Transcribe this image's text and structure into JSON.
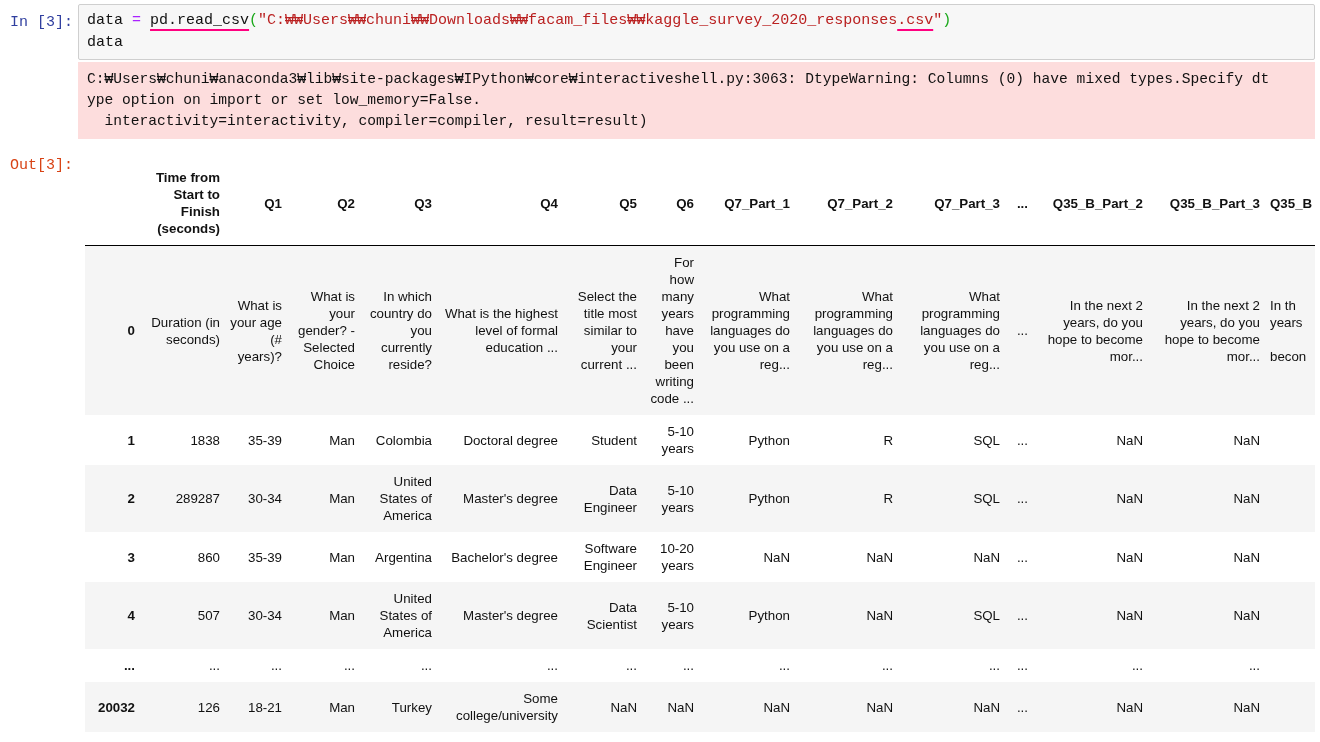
{
  "input_cell": {
    "prompt": "In [3]:",
    "code_lines": [
      [
        {
          "kind": "name",
          "text": "data "
        },
        {
          "kind": "operator",
          "text": "= "
        },
        {
          "kind": "name",
          "text": "pd.read_csv",
          "underlined": true
        },
        {
          "kind": "paren",
          "text": "("
        },
        {
          "kind": "string",
          "text": "\"C:₩₩Users₩₩chuni₩₩Downloads₩₩facam_files₩₩kaggle_survey_2020_responses"
        },
        {
          "kind": "string",
          "text": ".csv",
          "underlined": true
        },
        {
          "kind": "string",
          "text": "\""
        },
        {
          "kind": "paren",
          "text": ")"
        }
      ],
      [
        {
          "kind": "name",
          "text": "data"
        }
      ]
    ]
  },
  "warning_output": {
    "lines": [
      "C:₩Users₩chuni₩anaconda3₩lib₩site-packages₩IPython₩core₩interactiveshell.py:3063: DtypeWarning: Columns (0) have mixed types.Specify dt",
      "ype option on import or set low_memory=False.",
      "  interactivity=interactivity, compiler=compiler, result=result)"
    ]
  },
  "output_cell": {
    "prompt": "Out[3]:",
    "table": {
      "columns": [
        "Time from Start to Finish (seconds)",
        "Q1",
        "Q2",
        "Q3",
        "Q4",
        "Q5",
        "Q6",
        "Q7_Part_1",
        "Q7_Part_2",
        "Q7_Part_3",
        "...",
        "Q35_B_Part_2",
        "Q35_B_Part_3",
        "Q35_B"
      ],
      "rows": [
        {
          "index": "0",
          "cells": [
            "Duration (in seconds)",
            "What is your age (# years)?",
            "What is your gender? - Selected Choice",
            "In which country do you currently reside?",
            "What is the highest level of formal education ...",
            "Select the title most similar to your current ...",
            "For how many years have you been writing code ...",
            "What programming languages do you use on a reg...",
            "What programming languages do you use on a reg...",
            "What programming languages do you use on a reg...",
            "...",
            "In the next 2 years, do you hope to become mor...",
            "In the next 2 years, do you hope to become mor...",
            "In th\nyears\n\nbecon"
          ]
        },
        {
          "index": "1",
          "cells": [
            "1838",
            "35-39",
            "Man",
            "Colombia",
            "Doctoral degree",
            "Student",
            "5-10 years",
            "Python",
            "R",
            "SQL",
            "...",
            "NaN",
            "NaN",
            ""
          ]
        },
        {
          "index": "2",
          "cells": [
            "289287",
            "30-34",
            "Man",
            "United States of America",
            "Master's degree",
            "Data Engineer",
            "5-10 years",
            "Python",
            "R",
            "SQL",
            "...",
            "NaN",
            "NaN",
            ""
          ]
        },
        {
          "index": "3",
          "cells": [
            "860",
            "35-39",
            "Man",
            "Argentina",
            "Bachelor's degree",
            "Software Engineer",
            "10-20 years",
            "NaN",
            "NaN",
            "NaN",
            "...",
            "NaN",
            "NaN",
            ""
          ]
        },
        {
          "index": "4",
          "cells": [
            "507",
            "30-34",
            "Man",
            "United States of America",
            "Master's degree",
            "Data Scientist",
            "5-10 years",
            "Python",
            "NaN",
            "SQL",
            "...",
            "NaN",
            "NaN",
            ""
          ]
        },
        {
          "index": "...",
          "cells": [
            "...",
            "...",
            "...",
            "...",
            "...",
            "...",
            "...",
            "...",
            "...",
            "...",
            "...",
            "...",
            "...",
            ""
          ]
        },
        {
          "index": "20032",
          "cells": [
            "126",
            "18-21",
            "Man",
            "Turkey",
            "Some college/university",
            "NaN",
            "NaN",
            "NaN",
            "NaN",
            "NaN",
            "...",
            "NaN",
            "NaN",
            ""
          ]
        }
      ]
    }
  }
}
